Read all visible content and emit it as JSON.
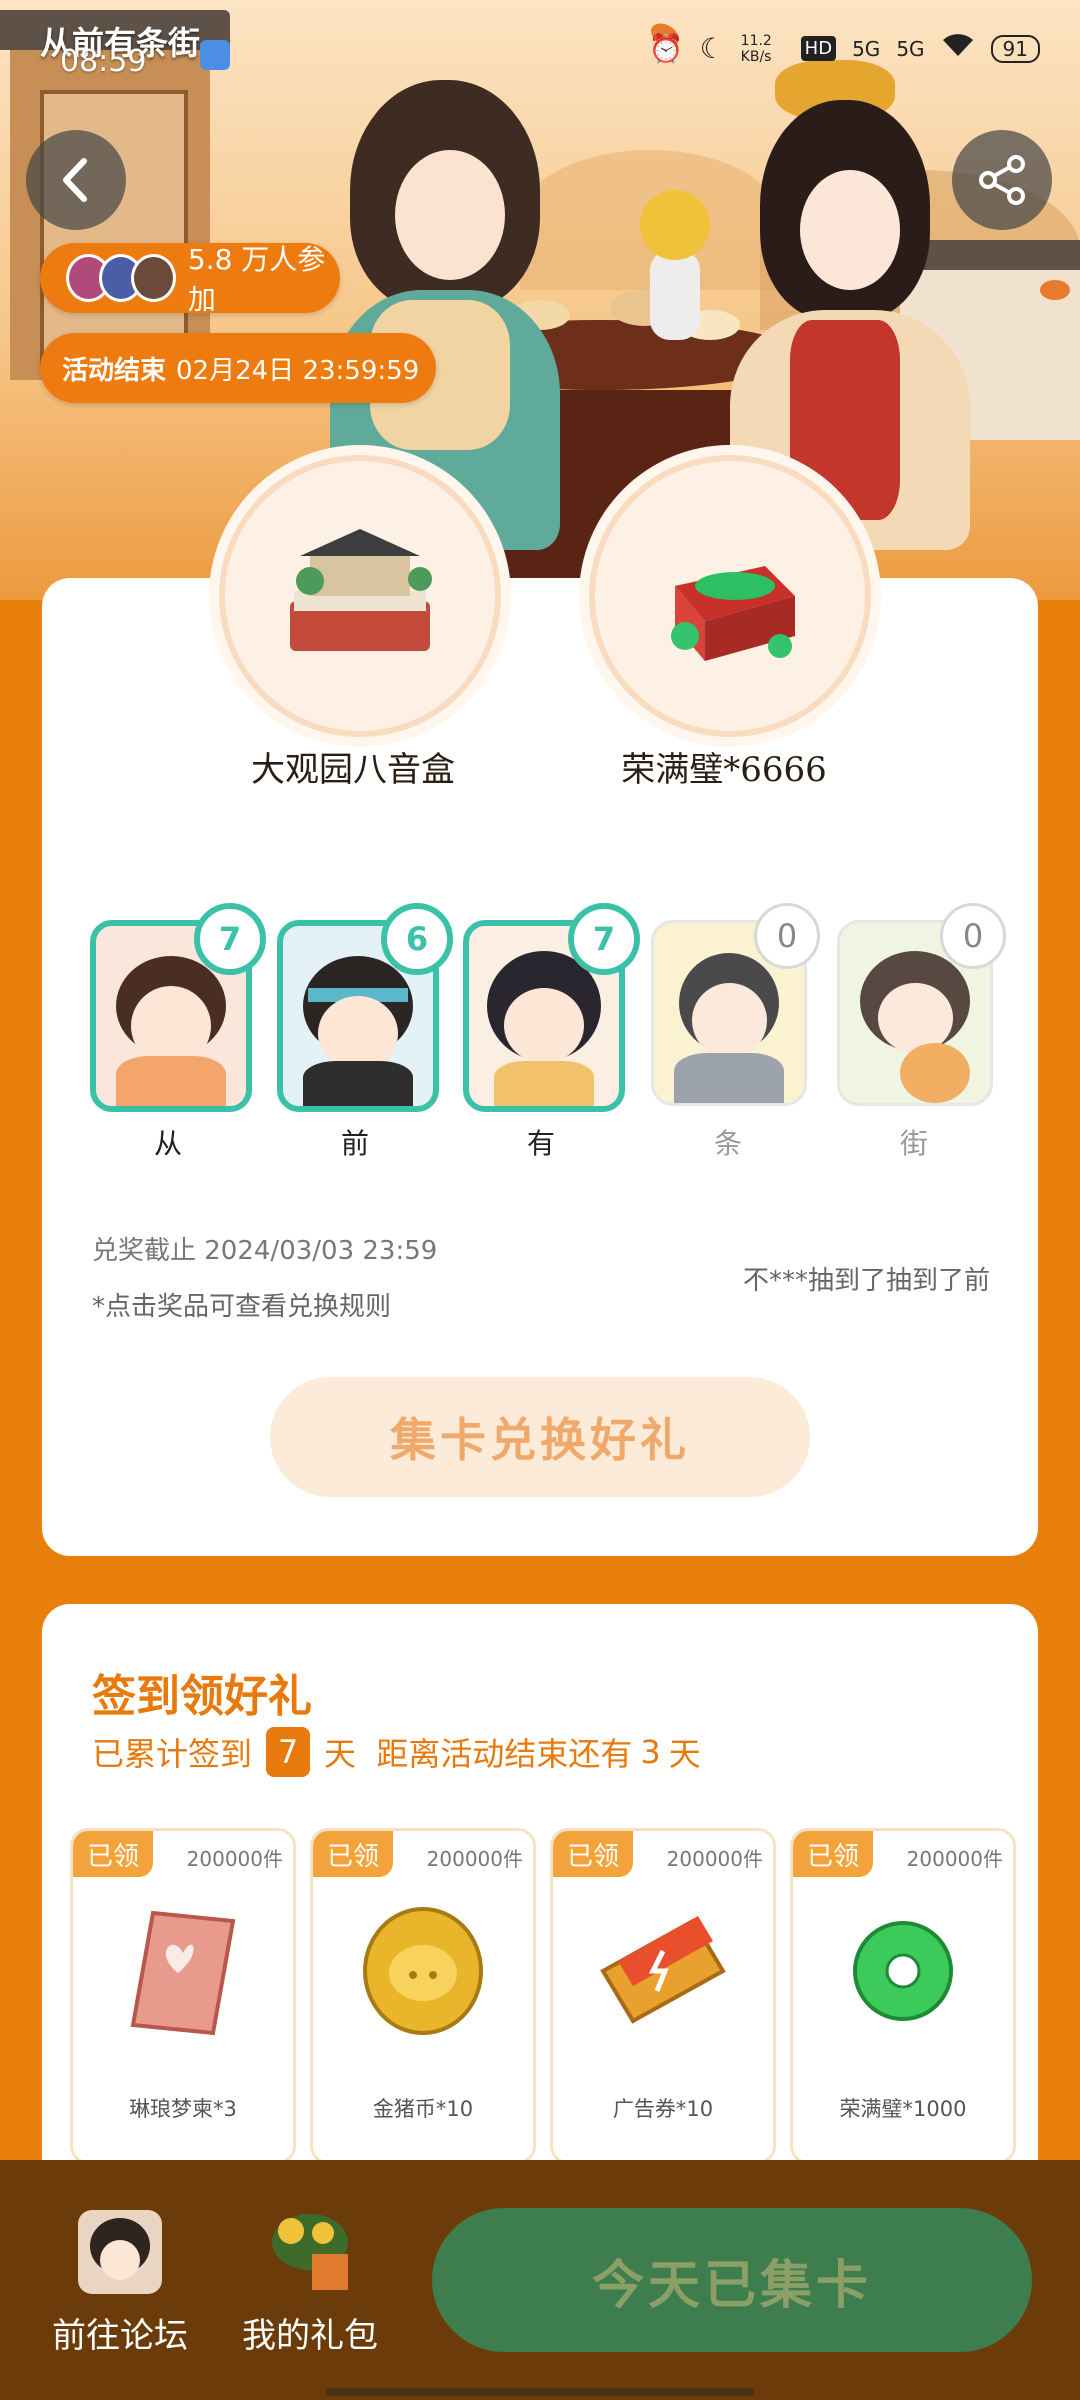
{
  "status": {
    "time": "08:59",
    "net_speed": "11.2 KB/s",
    "net1": "5G",
    "net2": "5G",
    "battery": "91"
  },
  "hero": {
    "logo_text": "从前有条街",
    "participants": "5.8 万人参加",
    "end_time_label": "活动结束",
    "end_time_value": "02月24日 23:59:59"
  },
  "prizes": [
    {
      "name": "大观园八音盒",
      "icon": "music-box-icon"
    },
    {
      "name": "荣满璧*6666",
      "icon": "jade-chest-icon"
    }
  ],
  "characters": [
    {
      "label": "从",
      "count": "7",
      "active": true
    },
    {
      "label": "前",
      "count": "6",
      "active": true
    },
    {
      "label": "有",
      "count": "7",
      "active": true
    },
    {
      "label": "条",
      "count": "0",
      "active": false
    },
    {
      "label": "街",
      "count": "0",
      "active": false
    }
  ],
  "redeem": {
    "deadline": "兑奖截止 2024/03/03 23:59",
    "note": "*点击奖品可查看兑换规则",
    "marquee": "不***抽到了抽到了前"
  },
  "exchange_button": "集卡兑换好礼",
  "signin": {
    "title": "签到领好礼",
    "prefix": "已累计签到",
    "days": "7",
    "suffix": "天  距离活动结束还有",
    "remain": "3",
    "remain_unit": "天",
    "gifts": [
      {
        "tag": "已领",
        "count": "200000件",
        "name": "琳琅梦柬*3",
        "icon": "letter-icon"
      },
      {
        "tag": "已领",
        "count": "200000件",
        "name": "金猪币*10",
        "icon": "gold-coin-icon"
      },
      {
        "tag": "已领",
        "count": "200000件",
        "name": "广告券*10",
        "icon": "ticket-icon"
      },
      {
        "tag": "已领",
        "count": "200000件",
        "name": "荣满璧*1000",
        "icon": "jade-ring-icon"
      }
    ]
  },
  "bottom": {
    "forum": "前往论坛",
    "gifts": "我的礼包",
    "collect": "今天已集卡"
  },
  "colors": {
    "orange": "#E87E0C",
    "teal": "#3BC1A8",
    "green_button": "#3E7D4D",
    "brown_bar": "#6B3C0A"
  }
}
